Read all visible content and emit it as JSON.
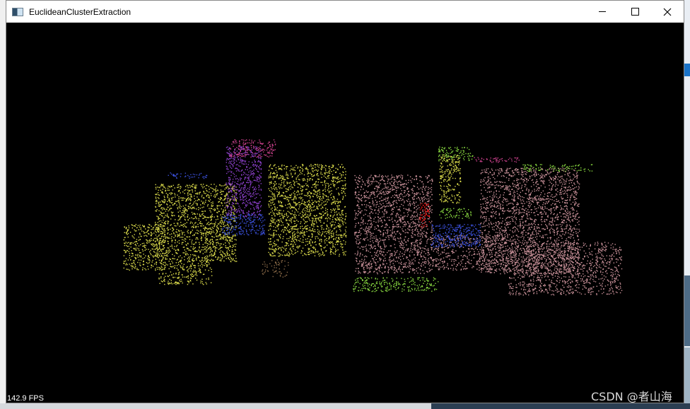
{
  "window": {
    "title": "EuclideanClusterExtraction",
    "controls": {
      "minimize": "minimize",
      "maximize": "maximize",
      "close": "close"
    }
  },
  "viewer": {
    "fps_label": "142.9 FPS",
    "background": "#000000"
  },
  "clusters": [
    {
      "name": "yellow-left",
      "color": "#d8d84a"
    },
    {
      "name": "purple",
      "color": "#8a3fc8"
    },
    {
      "name": "magenta",
      "color": "#c8408a"
    },
    {
      "name": "blue",
      "color": "#3a4fd8"
    },
    {
      "name": "pink",
      "color": "#c89098"
    },
    {
      "name": "green",
      "color": "#88d840"
    },
    {
      "name": "red",
      "color": "#e01818"
    },
    {
      "name": "brown",
      "color": "#8a6a48"
    }
  ],
  "watermark": "CSDN @者山海"
}
